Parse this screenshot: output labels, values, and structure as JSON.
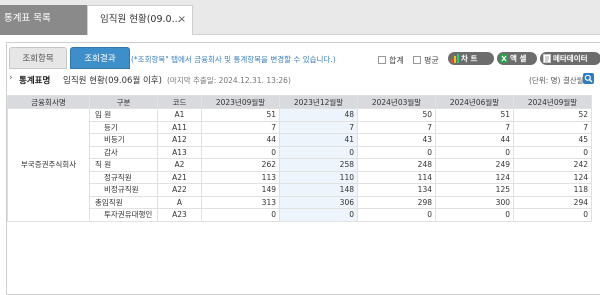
{
  "top_tabs": [
    {
      "label": "통계표 목록"
    },
    {
      "label": "임직원 현황(09.0...",
      "close": "×"
    }
  ],
  "sub_tabs": [
    {
      "label": "조회항목"
    },
    {
      "label": "조회결과"
    }
  ],
  "hint": "(*조회항목\" 탭에서 금융회사 및 통계항목을 변경할 수 있습니다.)",
  "options": [
    {
      "label": "합계"
    },
    {
      "label": "평균"
    }
  ],
  "buttons": [
    {
      "label": "차 트",
      "icon": "chart-icon"
    },
    {
      "label": "액 셀",
      "icon": "excel-icon"
    },
    {
      "label": "메타데이터",
      "icon": "document-icon"
    }
  ],
  "title_row": {
    "label": "통계표명",
    "name": "임직원 현황(09.06월 이후)",
    "date": "(마지막 추출일: 2024.12.31. 13:26)",
    "unit": "(단위: 명)  결산월"
  },
  "table": {
    "headers": [
      "금융회사명",
      "구분",
      "코드",
      "2023년09월말",
      "2023년12월말",
      "2024년03월말",
      "2024년06월말",
      "2024년09월말"
    ],
    "corp": "부국증권주식회사",
    "rows": [
      {
        "item": "임 원",
        "code": "A1",
        "values": [
          "51",
          "48",
          "50",
          "51",
          "52"
        ],
        "sub": false
      },
      {
        "item": "등기",
        "code": "A11",
        "values": [
          "7",
          "7",
          "7",
          "7",
          "7"
        ],
        "sub": true
      },
      {
        "item": "비등기",
        "code": "A12",
        "values": [
          "44",
          "41",
          "43",
          "44",
          "45"
        ],
        "sub": true
      },
      {
        "item": "감사",
        "code": "A13",
        "values": [
          "0",
          "0",
          "0",
          "0",
          "0"
        ],
        "sub": true
      },
      {
        "item": "직 원",
        "code": "A2",
        "values": [
          "262",
          "258",
          "248",
          "249",
          "242"
        ],
        "sub": false
      },
      {
        "item": "정규직원",
        "code": "A21",
        "values": [
          "113",
          "110",
          "114",
          "124",
          "124"
        ],
        "sub": true
      },
      {
        "item": "비정규직원",
        "code": "A22",
        "values": [
          "149",
          "148",
          "134",
          "125",
          "118"
        ],
        "sub": true
      },
      {
        "item": "총임직원",
        "code": "A",
        "values": [
          "313",
          "306",
          "298",
          "300",
          "294"
        ],
        "sub": false
      },
      {
        "item": "투자권유대행인",
        "code": "A23",
        "values": [
          "0",
          "0",
          "0",
          "0",
          "0"
        ],
        "sub": true
      }
    ]
  }
}
